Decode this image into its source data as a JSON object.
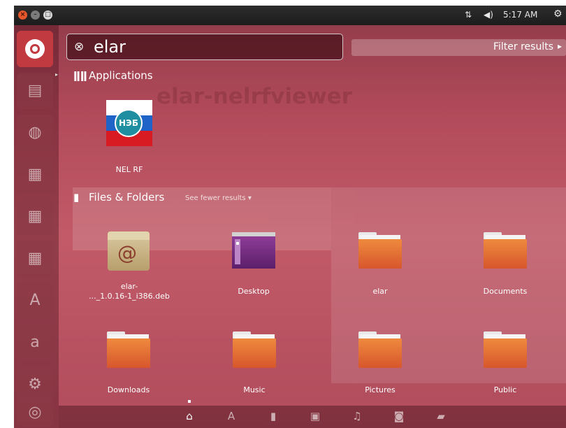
{
  "topbar": {
    "window_buttons": [
      "close-icon",
      "minimize-icon",
      "maximize-icon"
    ],
    "time": "5:17 AM",
    "icons": [
      "network-icon",
      "volume-icon",
      "settings-gear-icon"
    ]
  },
  "search": {
    "value": "elar",
    "clear_icon": "clear-icon"
  },
  "filter": {
    "label": "Filter results"
  },
  "background_window": {
    "title": "elar-nelrfviewer"
  },
  "applications": {
    "heading": "Applications",
    "items": [
      {
        "label": "NEL RF",
        "icon_text": "НЭБ"
      }
    ]
  },
  "files": {
    "heading": "Files & Folders",
    "see_fewer": "See fewer results",
    "items": [
      {
        "label": "elar-\n..._1.0.16-1_i386.deb",
        "icon": "debian-package-icon"
      },
      {
        "label": "Desktop",
        "icon": "desktop-folder-icon"
      },
      {
        "label": "elar",
        "icon": "folder-icon"
      },
      {
        "label": "Documents",
        "icon": "folder-icon"
      },
      {
        "label": "Downloads",
        "icon": "folder-icon"
      },
      {
        "label": "Music",
        "icon": "folder-icon"
      },
      {
        "label": "Pictures",
        "icon": "folder-icon"
      },
      {
        "label": "Public",
        "icon": "folder-icon"
      }
    ]
  },
  "launcher": {
    "items": [
      "ubuntu-home-icon",
      "files-icon",
      "firefox-icon",
      "writer-icon",
      "calc-icon",
      "impress-icon",
      "software-center-icon",
      "amazon-icon",
      "system-settings-icon",
      "trash-icon"
    ]
  },
  "lenses": [
    "home-lens-icon",
    "applications-lens-icon",
    "files-lens-icon",
    "video-lens-icon",
    "music-lens-icon",
    "photo-lens-icon",
    "social-lens-icon"
  ],
  "colors": {
    "accent": "#c03a3f",
    "folder": "#e9763a",
    "topbar": "#222222"
  }
}
